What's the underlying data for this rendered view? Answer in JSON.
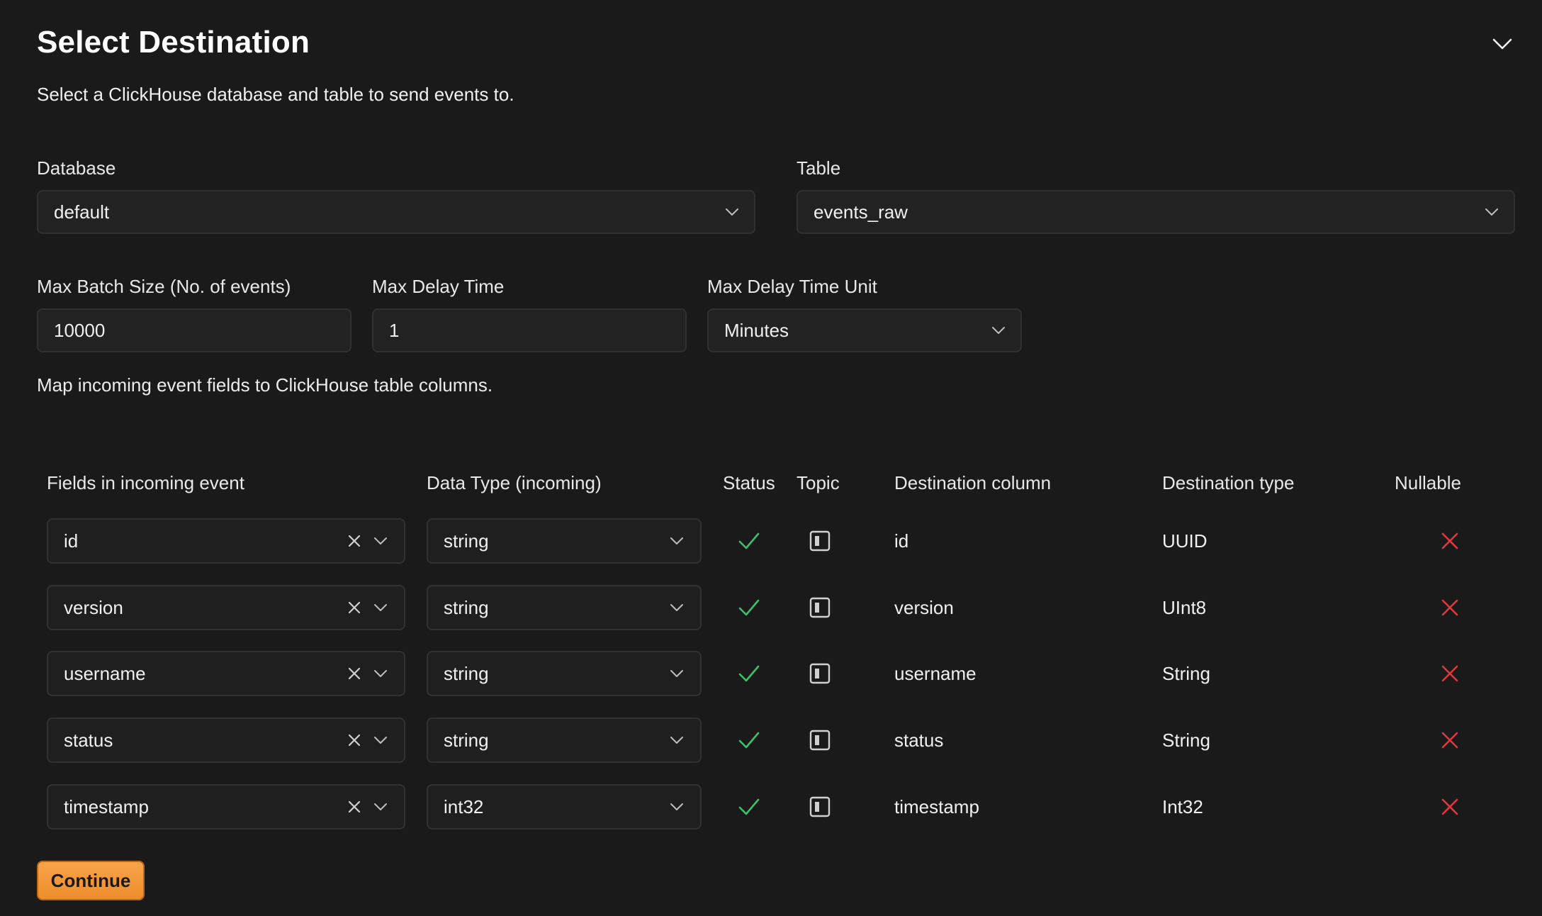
{
  "header": {
    "title": "Select Destination",
    "subtitle": "Select a ClickHouse database and table to send events to."
  },
  "database": {
    "label": "Database",
    "value": "default"
  },
  "table": {
    "label": "Table",
    "value": "events_raw"
  },
  "batch": {
    "max_batch_label": "Max Batch Size (No. of events)",
    "max_batch_value": "10000",
    "max_delay_label": "Max Delay Time",
    "max_delay_value": "1",
    "delay_unit_label": "Max Delay Time Unit",
    "delay_unit_value": "Minutes"
  },
  "mapping": {
    "hint": "Map incoming event fields to ClickHouse table columns.",
    "headers": {
      "field": "Fields in incoming event",
      "data_type": "Data Type (incoming)",
      "status": "Status",
      "topic": "Topic",
      "dest_column": "Destination column",
      "dest_type": "Destination type",
      "nullable": "Nullable"
    },
    "rows": [
      {
        "field": "id",
        "data_type": "string",
        "dest_column": "id",
        "dest_type": "UUID"
      },
      {
        "field": "version",
        "data_type": "string",
        "dest_column": "version",
        "dest_type": "UInt8"
      },
      {
        "field": "username",
        "data_type": "string",
        "dest_column": "username",
        "dest_type": "String"
      },
      {
        "field": "status",
        "data_type": "string",
        "dest_column": "status",
        "dest_type": "String"
      },
      {
        "field": "timestamp",
        "data_type": "int32",
        "dest_column": "timestamp",
        "dest_type": "Int32"
      }
    ]
  },
  "actions": {
    "continue_label": "Continue"
  },
  "colors": {
    "background": "#1a1a1a",
    "accent": "#f29a3c",
    "status_ok": "#3fbf6a",
    "nullable_no": "#e0383e"
  },
  "icons": {
    "collapse": "chevron-down-icon",
    "select_caret": "chevron-down-icon",
    "clear": "close-icon",
    "status": "check-icon",
    "topic": "topic-icon",
    "nullable": "cross-icon"
  }
}
